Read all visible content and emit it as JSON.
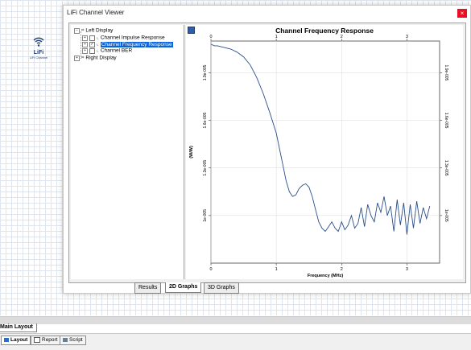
{
  "desktop": {
    "app_icon": {
      "name": "lifi-app-icon",
      "logo_text": "LiFi",
      "caption": "LiFi Channel"
    }
  },
  "window": {
    "title": "LiFi Channel Viewer",
    "close_glyph": "×",
    "tree": [
      {
        "label": "Left Display",
        "expander": "−",
        "checkbox": "",
        "icon": "⌗"
      },
      {
        "label": "Channel Impulse Response",
        "expander": "+",
        "checkbox": "",
        "icon": "⌞"
      },
      {
        "label": "Channel Frequency Response",
        "expander": "+",
        "checkbox": "✓",
        "icon": "⌞",
        "selected": true
      },
      {
        "label": "Channel BER",
        "expander": "+",
        "checkbox": "",
        "icon": "⌞"
      },
      {
        "label": "Right Display",
        "expander": "+",
        "checkbox": "",
        "icon": "⌗"
      }
    ],
    "graph_tabs": [
      {
        "label": "Results",
        "active": false
      },
      {
        "label": "2D Graphs",
        "active": true
      },
      {
        "label": "3D Graphs",
        "active": false
      }
    ]
  },
  "chart_data": {
    "type": "line",
    "title": "Channel Frequency Response",
    "xlabel": "Frequency (MHz)",
    "ylabel": "(W/W)",
    "xlim": [
      0,
      3.5
    ],
    "ylim": [
      7e-06,
      2.1e-05
    ],
    "x_ticks": [
      "0",
      "1",
      "2",
      "3"
    ],
    "y_ticks": [
      "1e-005",
      "1.3e-005",
      "1.6e-005",
      "1.9e-005"
    ],
    "grid": true,
    "series": [
      {
        "color": "#2b4e8a",
        "x": [
          0.0,
          0.05,
          0.1,
          0.2,
          0.3,
          0.4,
          0.5,
          0.6,
          0.7,
          0.8,
          0.9,
          1.0,
          1.05,
          1.1,
          1.15,
          1.2,
          1.25,
          1.3,
          1.35,
          1.4,
          1.45,
          1.5,
          1.55,
          1.6,
          1.65,
          1.7,
          1.75,
          1.8,
          1.85,
          1.9,
          1.95,
          2.0,
          2.05,
          2.1,
          2.15,
          2.2,
          2.25,
          2.3,
          2.35,
          2.4,
          2.45,
          2.5,
          2.55,
          2.6,
          2.65,
          2.7,
          2.75,
          2.8,
          2.85,
          2.9,
          2.95,
          3.0,
          3.05,
          3.1,
          3.15,
          3.2,
          3.25,
          3.3,
          3.35
        ],
        "y": [
          2.08e-05,
          2.07e-05,
          2.07e-05,
          2.06e-05,
          2.05e-05,
          2.03e-05,
          2e-05,
          1.95e-05,
          1.87e-05,
          1.77e-05,
          1.65e-05,
          1.52e-05,
          1.42e-05,
          1.32e-05,
          1.22e-05,
          1.15e-05,
          1.12e-05,
          1.13e-05,
          1.17e-05,
          1.19e-05,
          1.2e-05,
          1.18e-05,
          1.12e-05,
          1.04e-05,
          9.6e-06,
          9.2e-06,
          9e-06,
          9.3e-06,
          9.6e-06,
          9.2e-06,
          9e-06,
          9.6e-06,
          9.1e-06,
          9.4e-06,
          1e-05,
          9.2e-06,
          9.5e-06,
          1.05e-05,
          9.3e-06,
          1.07e-05,
          1e-05,
          9.6e-06,
          1.08e-05,
          1.02e-05,
          1.12e-05,
          1e-05,
          1.06e-05,
          9e-06,
          1.1e-05,
          9.4e-06,
          1.08e-05,
          8.8e-06,
          1.07e-05,
          9.2e-06,
          1.09e-05,
          9.5e-06,
          1.05e-05,
          9.8e-06,
          1.06e-05
        ]
      }
    ]
  },
  "bottom": {
    "main_layout_tab": "Main Layout",
    "tabs": [
      {
        "label": "Layout",
        "active": true
      },
      {
        "label": "Report",
        "active": false
      },
      {
        "label": "Script",
        "active": false
      }
    ]
  },
  "colors": {
    "accent": "#0a64d8",
    "close": "#e81123",
    "line": "#2b4e8a"
  }
}
